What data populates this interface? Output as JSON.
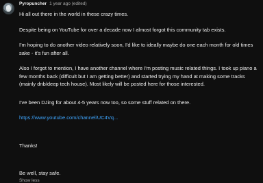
{
  "comment": {
    "author": "Pyropuncher",
    "timestamp": "1 year ago (edited)",
    "paragraphs": {
      "greeting": "Hi all out there in the world in these crazy times.",
      "intro": "Despite being on YouTube for over a decade now I almost forgot this community tab exists.",
      "video": "I'm hoping to do another video relatively soon, I'd like to ideally maybe do one each month for old times sake - it's fun after all.",
      "channel": "Also I forgot to mention, I have another channel where I'm posting music related things. I took up piano a few months back (difficult but I am getting better) and started trying my hand at making some tracks (mainly dnb/deep tech house). Most likely will be posted here for those interested.",
      "djing": "I've been DJing for about 4-5 years now too, so some stuff related on there.",
      "link": "https://www.youtube.com/channel/UC4Vq...",
      "thanks": "Thanks!",
      "signoff": "Be well, stay safe."
    },
    "show_less_label": "Show less"
  }
}
